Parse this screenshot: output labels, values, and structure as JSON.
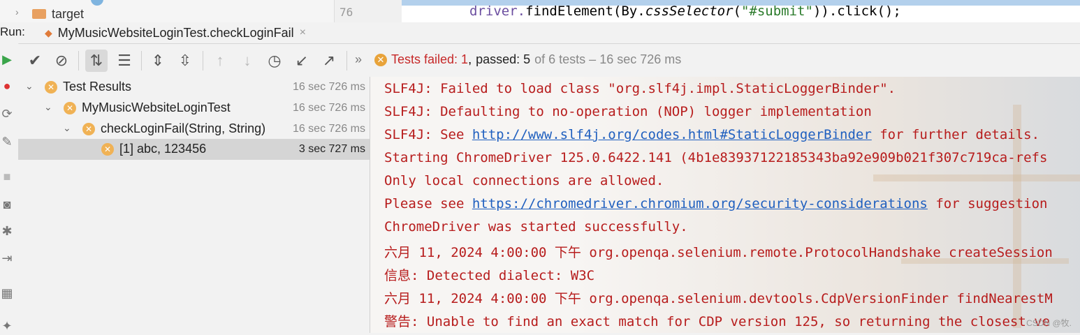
{
  "editor": {
    "tree_item_label": "target",
    "line_number": "76",
    "code": {
      "pre": "driver.",
      "method": "findElement",
      "mid": "(By.",
      "italic": "cssSelector",
      "open": "(",
      "string": "\"#submit\"",
      "post": ")).click();"
    }
  },
  "run_bar": {
    "label": "Run:",
    "tab_title": "MyMusicWebsiteLoginTest.checkLoginFail",
    "tab_close": "×"
  },
  "toolbar": {
    "icons": [
      "show-passed-icon",
      "show-ignored-icon",
      "sort-alpha-icon",
      "sort-duration-icon",
      "expand-all-icon",
      "collapse-all-icon",
      "prev-failed-icon",
      "next-failed-icon",
      "history-icon",
      "import-icon",
      "export-icon"
    ],
    "more": "»",
    "status": {
      "failed": "Tests failed: 1",
      "comma": ",",
      "passed": "passed: 5",
      "rest": "of 6 tests – 16 sec 726 ms"
    }
  },
  "tree": {
    "rows": [
      {
        "label": "Test Results",
        "time": "16 sec 726 ms"
      },
      {
        "label": "MyMusicWebsiteLoginTest",
        "time": "16 sec 726 ms"
      },
      {
        "label": "checkLoginFail(String, String)",
        "time": "16 sec 726 ms"
      },
      {
        "label": "[1] abc, 123456",
        "time": "3 sec 727 ms"
      }
    ]
  },
  "console": {
    "lines": [
      {
        "text": "SLF4J: Failed to load class \"org.slf4j.impl.StaticLoggerBinder\"."
      },
      {
        "text": "SLF4J: Defaulting to no-operation (NOP) logger implementation"
      },
      {
        "pre": "SLF4J: See ",
        "link": "http://www.slf4j.org/codes.html#StaticLoggerBinder",
        "post": " for further details."
      },
      {
        "text": "Starting ChromeDriver 125.0.6422.141 (4b1e83937122185343ba92e909b021f307c719ca-refs"
      },
      {
        "text": "Only local connections are allowed."
      },
      {
        "pre": "Please see ",
        "link": "https://chromedriver.chromium.org/security-considerations",
        "post": " for suggestion"
      },
      {
        "text": "ChromeDriver was started successfully."
      },
      {
        "text": "六月 11, 2024 4:00:00 下午 org.openqa.selenium.remote.ProtocolHandshake createSession"
      },
      {
        "text": "信息: Detected dialect: W3C"
      },
      {
        "text": "六月 11, 2024 4:00:00 下午 org.openqa.selenium.devtools.CdpVersionFinder findNearestM"
      },
      {
        "text": "警告: Unable to find an exact match for CDP version 125, so returning the closest ve"
      }
    ],
    "watermark": "CSDN @牧."
  }
}
